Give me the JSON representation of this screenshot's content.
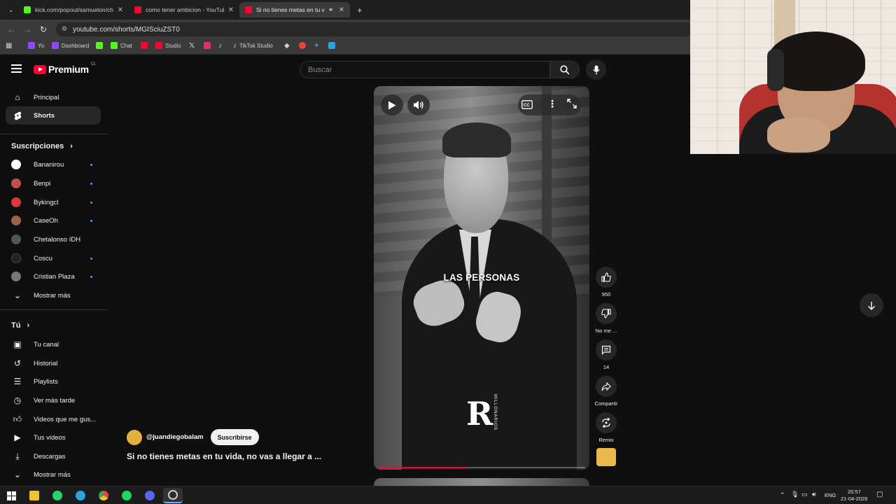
{
  "browser": {
    "tabs": [
      {
        "label": "kick.com/popout/samuelon/chat",
        "favicon_color": "#53fc18",
        "active": false
      },
      {
        "label": "como tener ambicion - YouTube",
        "favicon_color": "#ff0033",
        "active": false
      },
      {
        "label": "Si no tienes metas en tu vida",
        "favicon_color": "#ff0033",
        "active": true
      }
    ],
    "new_tab_label": "+",
    "url": "youtube.com/shorts/MGISciuZST0",
    "bookmarks": [
      {
        "label": "Yo",
        "icon_color": "#9146ff"
      },
      {
        "label": "Dashboard",
        "icon_color": "#9146ff"
      },
      {
        "label": "",
        "icon_color": "#53fc18"
      },
      {
        "label": "Chat",
        "icon_color": "#53fc18"
      },
      {
        "label": "",
        "icon_color": "#ff0033"
      },
      {
        "label": "Studio",
        "icon_color": "#ff0033"
      },
      {
        "label": "",
        "icon_color": "#ffffff"
      },
      {
        "label": "",
        "icon_color": "#e1306c"
      },
      {
        "label": "",
        "icon_color": "#ffffff"
      },
      {
        "label": "TikTok Studio",
        "icon_color": "#ffffff"
      },
      {
        "label": "",
        "icon_color": "#ffffff"
      },
      {
        "label": "",
        "icon_color": "#e8453c"
      },
      {
        "label": "",
        "icon_color": "#4a90e2"
      },
      {
        "label": "",
        "icon_color": "#2aa3df"
      }
    ]
  },
  "header": {
    "logo_text": "Premium",
    "country": "CL",
    "search_placeholder": "Buscar"
  },
  "sidebar": {
    "main": [
      {
        "label": "Principal",
        "icon": "home-icon"
      },
      {
        "label": "Shorts",
        "icon": "shorts-icon",
        "selected": true
      }
    ],
    "subs_heading": "Suscripciones",
    "subs": [
      {
        "label": "Bananirou",
        "avatar_color": "#ffffff",
        "dot": true
      },
      {
        "label": "Benpi",
        "avatar_color": "#c0504d",
        "dot": true
      },
      {
        "label": "Bykingcl",
        "avatar_color": "#d83a3a",
        "dot": true
      },
      {
        "label": "CaseOh",
        "avatar_color": "#a0604a",
        "dot": true
      },
      {
        "label": "Chetalonso IDH",
        "avatar_color": "#555555",
        "dot": false
      },
      {
        "label": "Coscu",
        "avatar_color": "#222222",
        "dot": true
      },
      {
        "label": "Cristian Plaza",
        "avatar_color": "#777777",
        "dot": true
      },
      {
        "label": "Mostrar más",
        "icon": "chevron-down-icon",
        "dot": false
      }
    ],
    "you_heading": "Tú",
    "you": [
      {
        "label": "Tu canal",
        "icon": "channel-icon"
      },
      {
        "label": "Historial",
        "icon": "history-icon"
      },
      {
        "label": "Playlists",
        "icon": "playlists-icon"
      },
      {
        "label": "Ver más tarde",
        "icon": "clock-icon"
      },
      {
        "label": "Videos que me gus...",
        "icon": "like-icon"
      },
      {
        "label": "Tus videos",
        "icon": "video-icon"
      },
      {
        "label": "Descargas",
        "icon": "download-icon"
      },
      {
        "label": "Mostrar más",
        "icon": "chevron-down-icon"
      }
    ]
  },
  "short": {
    "caption": "LAS PERSONAS",
    "watermark_letter": "R",
    "watermark_text": "MILLONARIOS",
    "progress": 0.43,
    "channel_handle": "@juandiegobalam",
    "subscribe_label": "Suscribirse",
    "title": "Si no tienes metas en tu vida, no vas a llegar a ..."
  },
  "actions": {
    "like_count": "950",
    "dislike_label": "No me ...",
    "comment_count": "14",
    "share_label": "Compartir",
    "remix_label": "Remix"
  },
  "taskbar": {
    "apps": [
      {
        "name": "file-explorer-icon",
        "color": "#f2c12e"
      },
      {
        "name": "whatsapp-icon",
        "color": "#25d366"
      },
      {
        "name": "telegram-icon",
        "color": "#2aa3df"
      },
      {
        "name": "chrome-icon",
        "color": "#e8453c"
      },
      {
        "name": "spotify-icon",
        "color": "#1ed760"
      },
      {
        "name": "discord-icon",
        "color": "#5865f2"
      },
      {
        "name": "obs-icon",
        "color": "#cccccc"
      }
    ],
    "language": "ENG",
    "time": "20:57",
    "date": "21-04-2026"
  }
}
